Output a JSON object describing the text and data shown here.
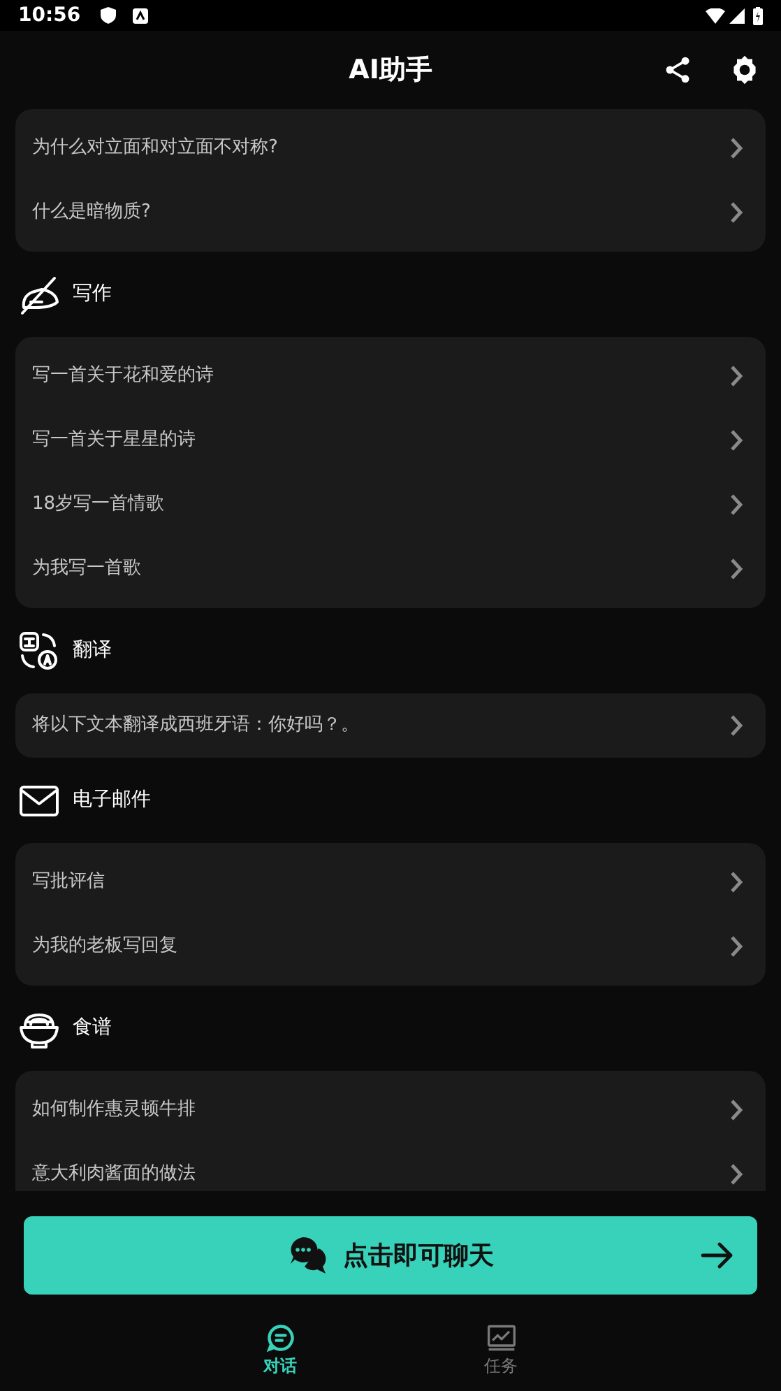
{
  "status_bar": {
    "time": "10:56"
  },
  "header": {
    "title": "AI助手"
  },
  "sections": [
    {
      "items": [
        "为什么对立面和对立面不对称?",
        "什么是暗物质?"
      ]
    },
    {
      "title": "写作",
      "kind": "writing",
      "items": [
        "写一首关于花和爱的诗",
        "写一首关于星星的诗",
        "18岁写一首情歌",
        "为我写一首歌"
      ]
    },
    {
      "title": "翻译",
      "kind": "translate",
      "items": [
        "将以下文本翻译成西班牙语：你好吗？。"
      ]
    },
    {
      "title": "电子邮件",
      "kind": "mail",
      "items": [
        "写批评信",
        "为我的老板写回复"
      ]
    },
    {
      "title": "食谱",
      "kind": "recipe",
      "items": [
        "如何制作惠灵顿牛排",
        "意大利肉酱面的做法"
      ]
    }
  ],
  "chat_button": {
    "label": "点击即可聊天"
  },
  "nav": [
    {
      "label": "对话",
      "kind": "chat",
      "selected": true
    },
    {
      "label": "任务",
      "kind": "chart",
      "selected": false
    }
  ]
}
